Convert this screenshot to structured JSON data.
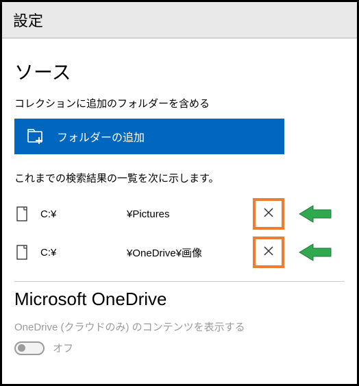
{
  "titlebar": {
    "title": "設定"
  },
  "source": {
    "heading": "ソース",
    "include_label": "コレクションに追加のフォルダーを含める",
    "add_button_label": "フォルダーの追加",
    "results_label": "これまでの検索結果の一覧を次に示します。"
  },
  "folders": [
    {
      "drive": "C:¥",
      "path": "¥Pictures"
    },
    {
      "drive": "C:¥",
      "path": "¥OneDrive¥画像"
    }
  ],
  "onedrive": {
    "heading": "Microsoft OneDrive",
    "desc": "OneDrive (クラウドのみ) のコンテンツを表示する",
    "toggle_state": "オフ"
  },
  "annotations": {
    "highlight_color": "#ed7d31",
    "arrow_color": "#2fa84f"
  }
}
